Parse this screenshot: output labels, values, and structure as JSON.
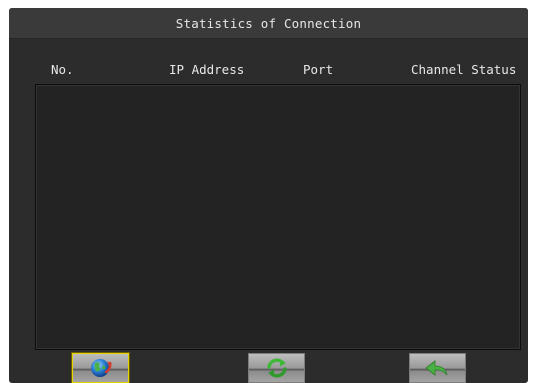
{
  "window": {
    "title": "Statistics of Connection"
  },
  "table": {
    "columns": [
      "No.",
      "IP Address",
      "Port",
      "Channel Status"
    ],
    "rows": []
  },
  "toolbar": {
    "buttons": [
      {
        "icon": "globe-icon",
        "selected": true
      },
      {
        "icon": "refresh-icon",
        "selected": false
      },
      {
        "icon": "back-arrow-icon",
        "selected": false
      }
    ]
  },
  "colors": {
    "background": "#2c2c2c",
    "titlebar": "#3a3a3a",
    "list": "#232323",
    "selection": "#e5d400",
    "refresh_green": "#3fb83a"
  }
}
